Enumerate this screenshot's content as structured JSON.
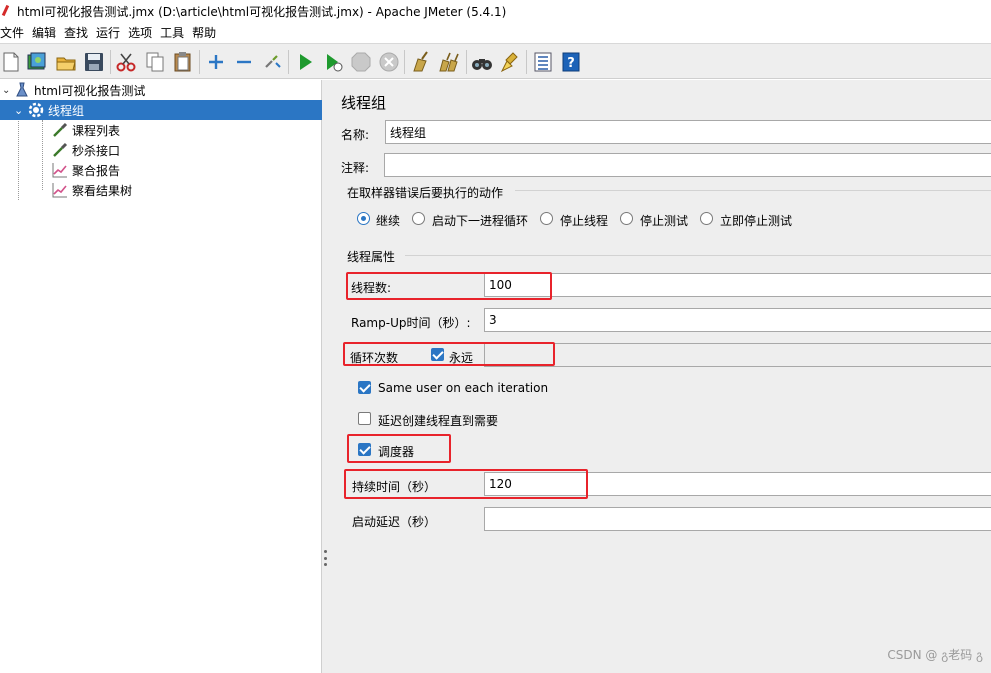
{
  "window": {
    "title": "html可视化报告测试.jmx (D:\\article\\html可视化报告测试.jmx) - Apache JMeter (5.4.1)"
  },
  "menu": [
    "文件",
    "编辑",
    "查找",
    "运行",
    "选项",
    "工具",
    "帮助"
  ],
  "toolbar": {
    "icons": [
      "new-icon",
      "templates-icon",
      "open-icon",
      "save-icon",
      "cut-icon",
      "copy-icon",
      "paste-icon",
      "expand-icon",
      "collapse-icon",
      "toggle-icon",
      "start-icon",
      "start-no-pause-icon",
      "stop-icon",
      "shutdown-icon",
      "clear-icon",
      "clear-all-icon",
      "search-icon",
      "reset-search-icon",
      "function-helper-icon",
      "help-icon"
    ]
  },
  "tree": {
    "root": "html可视化报告测试",
    "thread_group": "线程组",
    "children": [
      "课程列表",
      "秒杀接口",
      "聚合报告",
      "察看结果树"
    ]
  },
  "form": {
    "title": "线程组",
    "name_label": "名称:",
    "name_value": "线程组",
    "comment_label": "注释:",
    "comment_value": "",
    "error_action_label": "在取样器错误后要执行的动作",
    "error_actions": [
      "继续",
      "启动下一进程循环",
      "停止线程",
      "停止测试",
      "立即停止测试"
    ],
    "error_action_selected": "继续",
    "props_label": "线程属性",
    "threads_label": "线程数:",
    "threads_value": "100",
    "rampup_label": "Ramp-Up时间（秒）:",
    "rampup_value": "3",
    "loop_label": "循环次数",
    "loop_forever_label": "永远",
    "loop_forever_checked": true,
    "same_user_label": "Same user on each iteration",
    "same_user_checked": true,
    "delay_create_label": "延迟创建线程直到需要",
    "delay_create_checked": false,
    "scheduler_label": "调度器",
    "scheduler_checked": true,
    "duration_label": "持续时间（秒）",
    "duration_value": "120",
    "startup_delay_label": "启动延迟（秒）",
    "startup_delay_value": ""
  },
  "colors": {
    "highlight": "#e8232b",
    "selection": "#2b76c4",
    "panel": "#eeeeee"
  },
  "watermark": "CSDN @ გ老码 გ"
}
